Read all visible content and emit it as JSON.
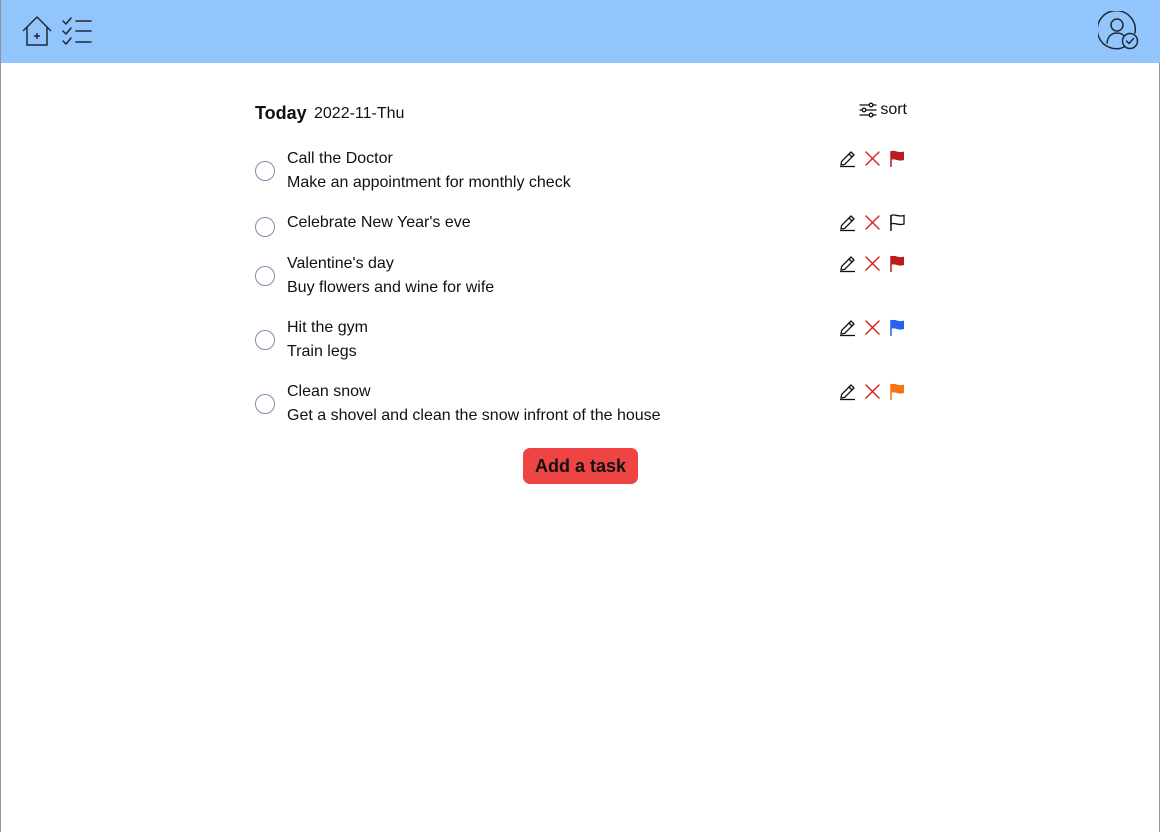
{
  "nav": {
    "home_icon": "home-icon",
    "tasks_icon": "checklist-icon",
    "profile_icon": "user-check-icon",
    "bar_color": "#93c5fd"
  },
  "header": {
    "title": "Today",
    "date": "2022-11-Thu",
    "sort_label": "sort"
  },
  "tasks": [
    {
      "title": "Call the Doctor",
      "description": "Make an appointment for monthly check",
      "flag": "red"
    },
    {
      "title": "Celebrate New Year's eve",
      "description": "",
      "flag": "none"
    },
    {
      "title": "Valentine's day",
      "description": "Buy flowers and wine for wife",
      "flag": "red"
    },
    {
      "title": "Hit the gym",
      "description": "Train legs",
      "flag": "blue"
    },
    {
      "title": "Clean snow",
      "description": "Get a shovel and clean the snow infront of the house",
      "flag": "orange"
    }
  ],
  "flag_colors": {
    "red": "#b91c1c",
    "blue": "#2563eb",
    "orange": "#f97316",
    "none": "#111111"
  },
  "add_button": {
    "label": "Add a task",
    "color": "#ef4444"
  }
}
